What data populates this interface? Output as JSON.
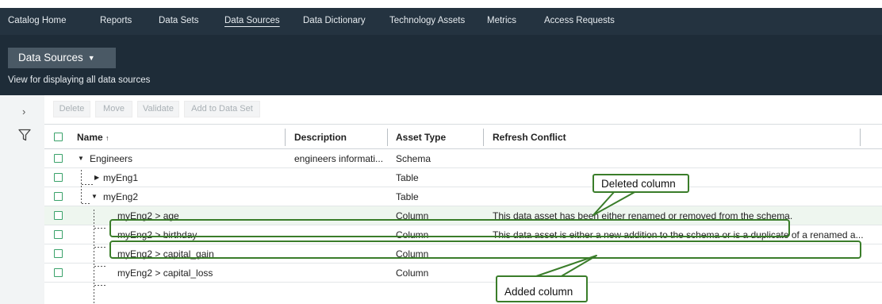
{
  "nav": {
    "items": [
      {
        "label": "Catalog Home"
      },
      {
        "label": "Reports"
      },
      {
        "label": "Data Sets"
      },
      {
        "label": "Data Sources"
      },
      {
        "label": "Data Dictionary"
      },
      {
        "label": "Technology Assets"
      },
      {
        "label": "Metrics"
      },
      {
        "label": "Access Requests"
      }
    ],
    "active": "Data Sources"
  },
  "header": {
    "title": "Data Sources",
    "caret_icon": "caret-down-icon",
    "subtitle": "View for displaying all data sources"
  },
  "sidebar": {
    "expand_icon": "chevron-right-icon",
    "filter_icon": "funnel-icon"
  },
  "toolbar": {
    "delete_label": "Delete",
    "move_label": "Move",
    "validate_label": "Validate",
    "add_label": "Add to Data Set"
  },
  "table": {
    "columns": {
      "name": "Name",
      "sort_indicator": "↑",
      "description": "Description",
      "asset_type": "Asset Type",
      "refresh_conflict": "Refresh Conflict"
    },
    "rows": [
      {
        "name": "Engineers",
        "description": "engineers informati...",
        "type": "Schema",
        "conflict": ""
      },
      {
        "name": "myEng1",
        "description": "",
        "type": "Table",
        "conflict": ""
      },
      {
        "name": "myEng2",
        "description": "",
        "type": "Table",
        "conflict": ""
      },
      {
        "name": "myEng2 > age",
        "description": "",
        "type": "Column",
        "conflict": "This data asset has been either renamed or removed from the schema."
      },
      {
        "name": "myEng2 > birthday",
        "description": "",
        "type": "Column",
        "conflict": "This data asset is either a new addition to the schema or is a duplicate of a renamed a..."
      },
      {
        "name": "myEng2 > capital_gain",
        "description": "",
        "type": "Column",
        "conflict": ""
      },
      {
        "name": "myEng2 > capital_loss",
        "description": "",
        "type": "Column",
        "conflict": ""
      }
    ]
  },
  "annotations": {
    "deleted": "Deleted column",
    "added": "Added column"
  },
  "colors": {
    "nav_bg": "#243340",
    "hero_bg": "#1e2c38",
    "checkbox": "#3aa26a",
    "annotation": "#3a7d2a"
  }
}
